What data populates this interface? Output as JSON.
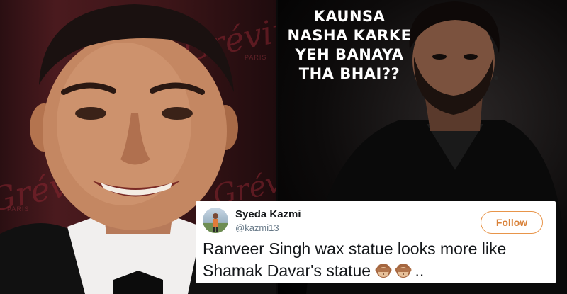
{
  "meme": {
    "caption_lines": [
      "KAUNSA",
      "NASHA KARKE",
      "YEH BANAYA",
      "THA BHAI??"
    ],
    "background_logo": "Grévin",
    "background_sub": "PARIS"
  },
  "tweet": {
    "author_name": "Syeda Kazmi",
    "author_handle": "@kazmi13",
    "follow_label": "Follow",
    "text_line1": "Ranveer Singh wax statue looks more like",
    "text_line2": "Shamak Davar's statue",
    "text_suffix": "..",
    "emoji_icons": [
      "see-no-evil-monkey-icon",
      "see-no-evil-monkey-icon"
    ]
  },
  "colors": {
    "follow_accent": "#d9823a",
    "left_backdrop": "#4a1a1e"
  }
}
